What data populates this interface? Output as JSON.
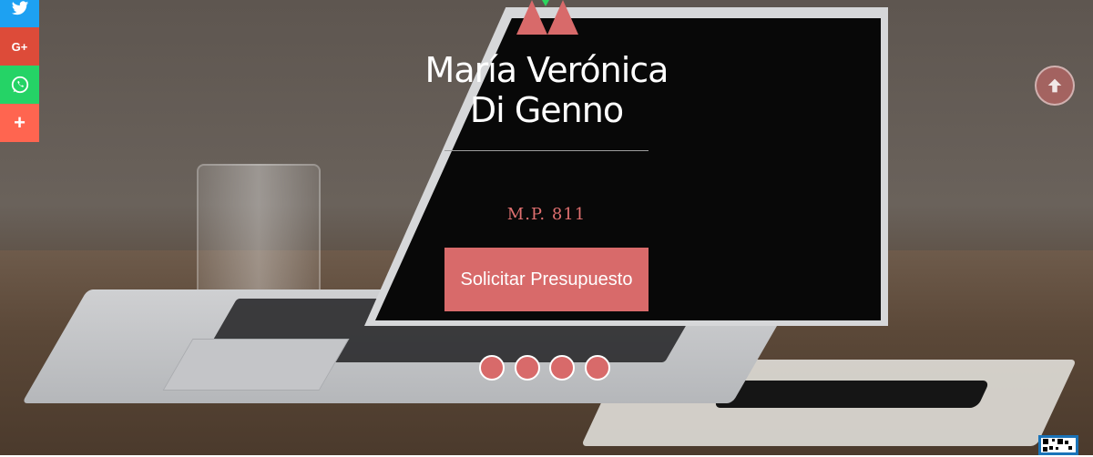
{
  "profile": {
    "name_line1": "María Verónica",
    "name_line2": "Di Genno",
    "license": "M.P. 811"
  },
  "hero": {
    "cta_label": "Solicitar Presupuesto",
    "slides_count": 4
  },
  "share": {
    "googleplus_label": "G+",
    "more_label": "+"
  },
  "icons": {
    "twitter": "twitter-icon",
    "googleplus": "googleplus-icon",
    "whatsapp": "whatsapp-icon",
    "more": "plus-icon",
    "scroll_top": "arrow-up-icon",
    "qr": "qr-code-icon"
  },
  "colors": {
    "accent": "#d86a6a",
    "twitter": "#1da1f2",
    "googleplus": "#dd4b39",
    "whatsapp": "#25d366",
    "more": "#ff6550"
  }
}
